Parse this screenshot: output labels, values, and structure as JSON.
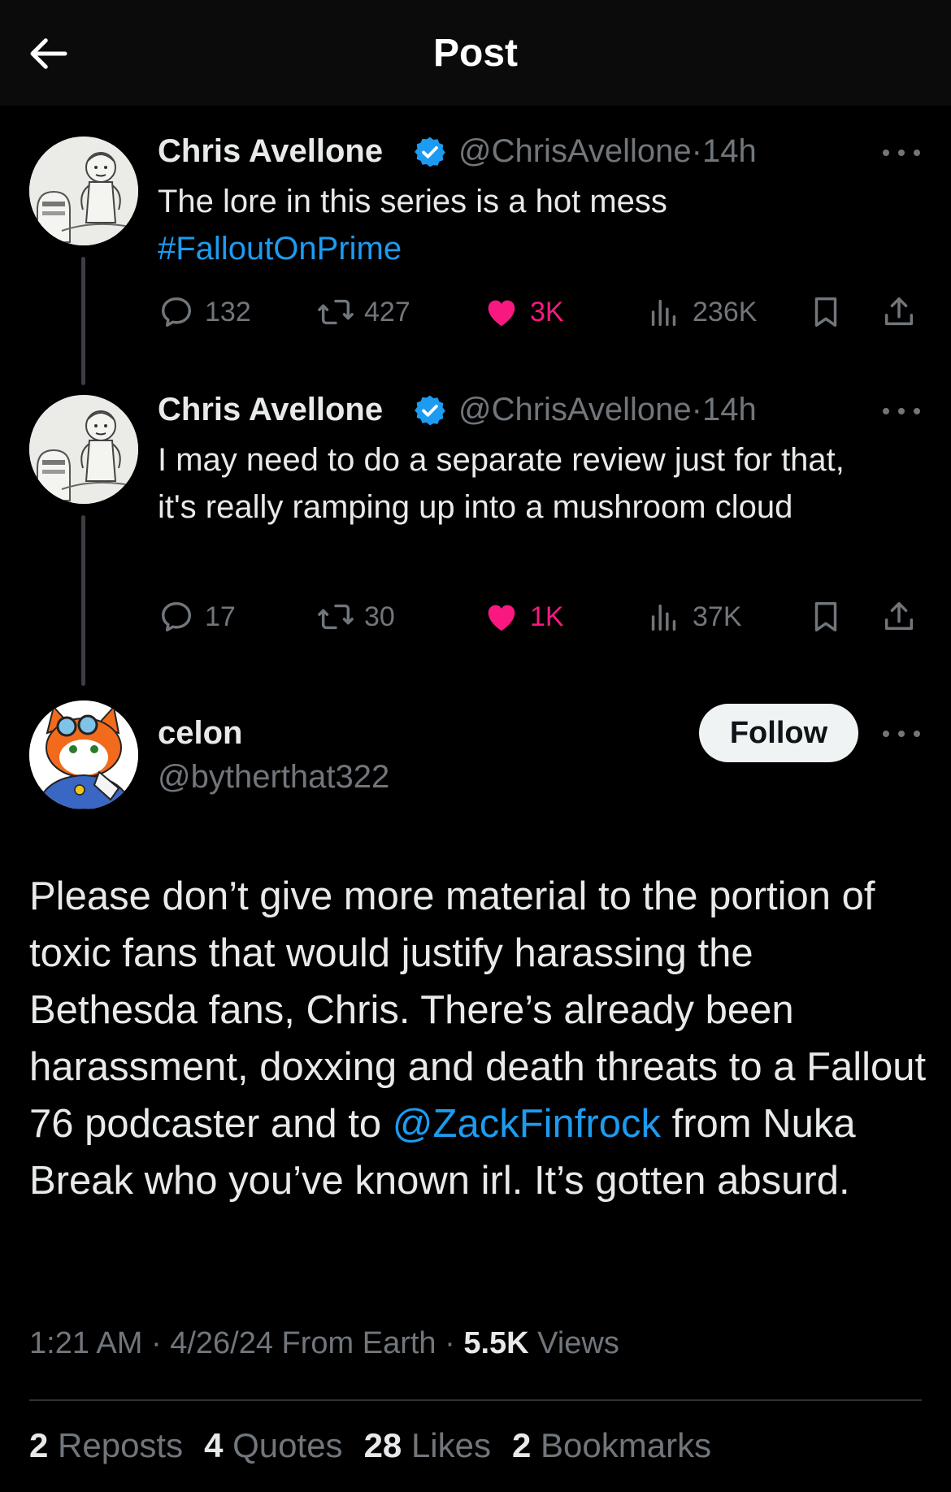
{
  "header": {
    "title": "Post"
  },
  "tweets": [
    {
      "name": "Chris Avellone",
      "handle": "@ChrisAvellone",
      "time": "14h",
      "text": "The lore in this series is a hot mess",
      "hashtag": "#FalloutOnPrime",
      "replies": "132",
      "reposts": "427",
      "likes": "3K",
      "views": "236K"
    },
    {
      "name": "Chris Avellone",
      "handle": "@ChrisAvellone",
      "time": "14h",
      "text": "I may need to do a separate review just for that, it's really ramping up into a mushroom cloud",
      "replies": "17",
      "reposts": "30",
      "likes": "1K",
      "views": "37K"
    }
  ],
  "main_post": {
    "name": "celon",
    "handle": "@bytherthat322",
    "follow_label": "Follow",
    "text_before": "Please don’t give more material to the portion of toxic fans that would justify harassing the Bethesda fans, Chris. There’s already been harassment, doxxing and death threats to a Fallout 76 podcaster and to ",
    "mention": "@ZackFinfrock",
    "text_after": " from Nuka Break who you’ve known irl. It’s gotten absurd.",
    "meta_time": "1:21 AM · 4/26/24 From Earth · ",
    "views_count": "5.5K",
    "views_label": " Views",
    "stats": {
      "reposts_count": "2",
      "reposts_label": " Reposts",
      "quotes_count": "4",
      "quotes_label": " Quotes",
      "likes_count": "28",
      "likes_label": " Likes",
      "bookmarks_count": "2",
      "bookmarks_label": " Bookmarks"
    }
  },
  "colors": {
    "background": "#000000",
    "link": "#1d9bf0",
    "like": "#f91880",
    "muted": "#71767b",
    "verified": "#1d9bf0"
  },
  "icons": [
    "back-arrow-icon",
    "verified-icon",
    "more-icon",
    "reply-icon",
    "repost-icon",
    "like-icon",
    "views-icon",
    "bookmark-icon",
    "share-icon"
  ]
}
